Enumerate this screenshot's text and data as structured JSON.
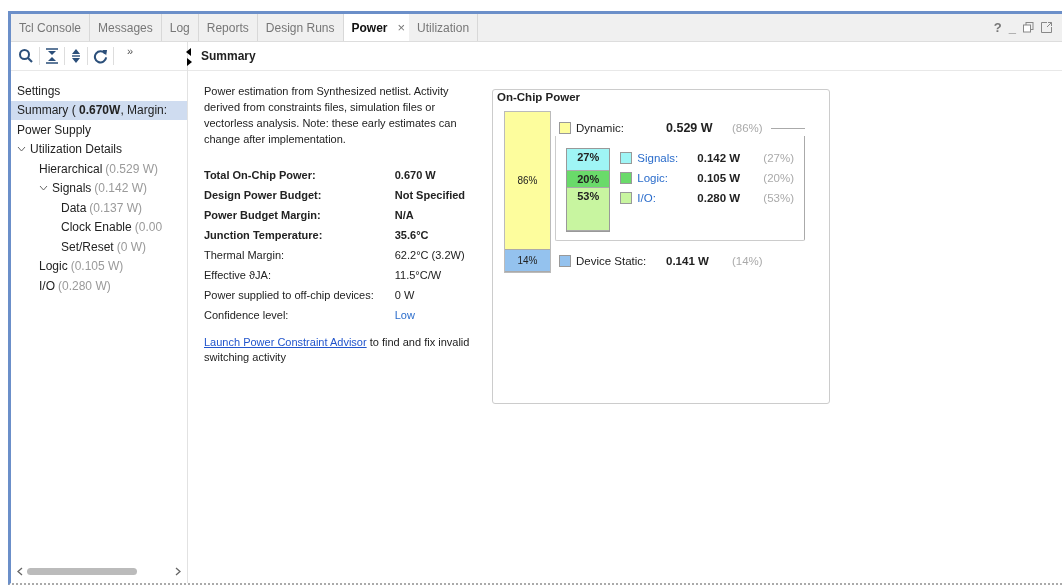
{
  "tabs": [
    {
      "label": "Tcl Console",
      "selected": false
    },
    {
      "label": "Messages",
      "selected": false
    },
    {
      "label": "Log",
      "selected": false
    },
    {
      "label": "Reports",
      "selected": false
    },
    {
      "label": "Design Runs",
      "selected": false
    },
    {
      "label": "Power",
      "selected": true,
      "close": "×"
    },
    {
      "label": "Utilization",
      "selected": false
    }
  ],
  "window_controls": [
    "?",
    "_"
  ],
  "toolbar": {
    "overflow": "»"
  },
  "tree": [
    {
      "label": "Settings",
      "selected": false
    },
    {
      "label": "Summary ( **0.670W**, Margin:",
      "selected": true
    },
    {
      "label": "Power Supply",
      "selected": false
    },
    {
      "label": "Utilization Details",
      "selected": false,
      "expanded": true,
      "children": [
        {
          "label": "Hierarchical",
          "value": "(0.529 W)",
          "selected": false
        },
        {
          "label": "Signals",
          "value": "(0.142 W)",
          "selected": false,
          "expanded": true,
          "children": [
            {
              "label": "Data",
              "value": "(0.137 W)",
              "selected": false
            },
            {
              "label": "Clock Enable",
              "value": "(0.00",
              "selected": false
            },
            {
              "label": "Set/Reset",
              "value": "(0 W)",
              "selected": false
            }
          ]
        },
        {
          "label": "Logic",
          "value": "(0.105 W)",
          "selected": false
        },
        {
          "label": "I/O",
          "value": "(0.280 W)",
          "selected": false
        }
      ]
    }
  ],
  "summary": {
    "title": "Summary",
    "description": "Power estimation from Synthesized netlist. Activity derived from constraints files, simulation files or vectorless analysis. Note: these early estimates can change after implementation.",
    "rows": [
      {
        "label": "Total On-Chip Power:",
        "value": "0.670 W",
        "bold": true,
        "kind": "text"
      },
      {
        "label": "Design Power Budget:",
        "value": "Not Specified",
        "bold": true,
        "kind": "text"
      },
      {
        "label": "Power Budget Margin:",
        "value": "N/A",
        "bold": true,
        "kind": "text"
      },
      {
        "label": "Junction Temperature:",
        "value": "35.6°C",
        "bold": true,
        "kind": "text"
      },
      {
        "label": "Thermal Margin:",
        "value": "62.2°C (3.2W)",
        "bold": false,
        "kind": "text"
      },
      {
        "label": "Effective ϑJA:",
        "value": "11.5°C/W",
        "bold": false,
        "kind": "text"
      },
      {
        "label": "Power supplied to off-chip devices:",
        "value": "0 W",
        "bold": false,
        "kind": "text"
      },
      {
        "label": "Confidence level:",
        "value": "Low",
        "bold": false,
        "kind": "link"
      }
    ],
    "advisor_link": "Launch Power Constraint Advisor",
    "advisor_text": "to find and fix invalid switching activity"
  },
  "on_chip_power": {
    "title": "On-Chip Power",
    "bar": [
      {
        "share": "86%",
        "level": 0.86,
        "color": "#fdfd9d"
      },
      {
        "share": "14%",
        "level": 0.14,
        "color": "#94c2ee"
      }
    ],
    "dynamic": {
      "label": "Dynamic:",
      "value": "0.529 W",
      "percent": "(86%)",
      "color": "#fdfd9d",
      "items": [
        {
          "label": "Signals:",
          "value": "0.142 W",
          "percent": "(27%)",
          "share": "27%",
          "color": "#9ff5f5"
        },
        {
          "label": "Logic:",
          "value": "0.105 W",
          "percent": "(20%)",
          "share": "20%",
          "color": "#6ada6a"
        },
        {
          "label": "I/O:",
          "value": "0.280 W",
          "percent": "(53%)",
          "share": "53%",
          "color": "#c8f5a0"
        }
      ]
    },
    "static": {
      "label": "Device Static:",
      "value": "0.141 W",
      "percent": "(14%)",
      "color": "#94c2ee"
    }
  }
}
